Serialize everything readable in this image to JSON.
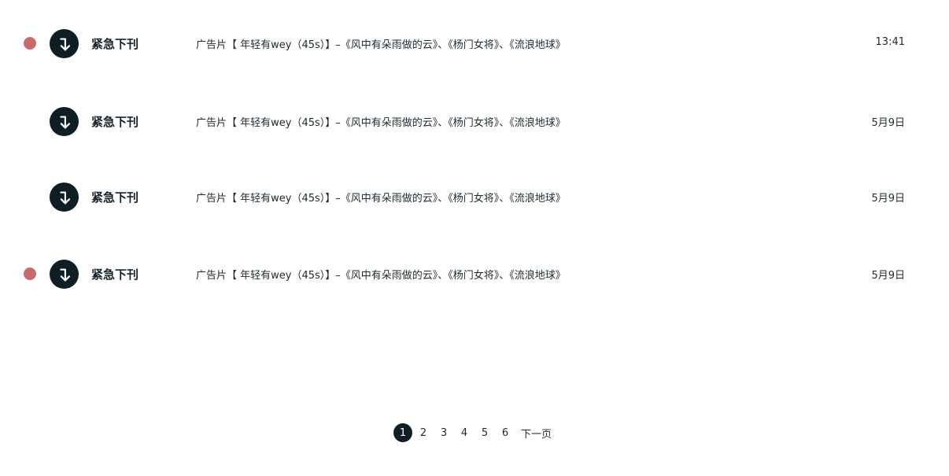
{
  "colors": {
    "unread_dot": "#c96a6d",
    "avatar_bg": "#0f1d24",
    "active_page_bg": "#0f1d24",
    "text": "#1f2a30"
  },
  "notifications": [
    {
      "unread": true,
      "icon": "arrow-down-return-icon",
      "category": "紧急下刊",
      "message": "广告片【 年轻有wey（45s）】–《风中有朵雨做的云》、《杨门女将》、《流浪地球》",
      "time": "13:41"
    },
    {
      "unread": false,
      "icon": "arrow-down-return-icon",
      "category": "紧急下刊",
      "message": "广告片【 年轻有wey（45s）】–《风中有朵雨做的云》、《杨门女将》、《流浪地球》",
      "time": "5月9日"
    },
    {
      "unread": false,
      "icon": "arrow-down-return-icon",
      "category": "紧急下刊",
      "message": "广告片【 年轻有wey（45s）】–《风中有朵雨做的云》、《杨门女将》、《流浪地球》",
      "time": "5月9日"
    },
    {
      "unread": true,
      "icon": "arrow-down-return-icon",
      "category": "紧急下刊",
      "message": "广告片【 年轻有wey（45s）】–《风中有朵雨做的云》、《杨门女将》、《流浪地球》",
      "time": "5月9日"
    }
  ],
  "pagination": {
    "pages": [
      "1",
      "2",
      "3",
      "4",
      "5",
      "6"
    ],
    "current": "1",
    "next_label": "下一页"
  }
}
